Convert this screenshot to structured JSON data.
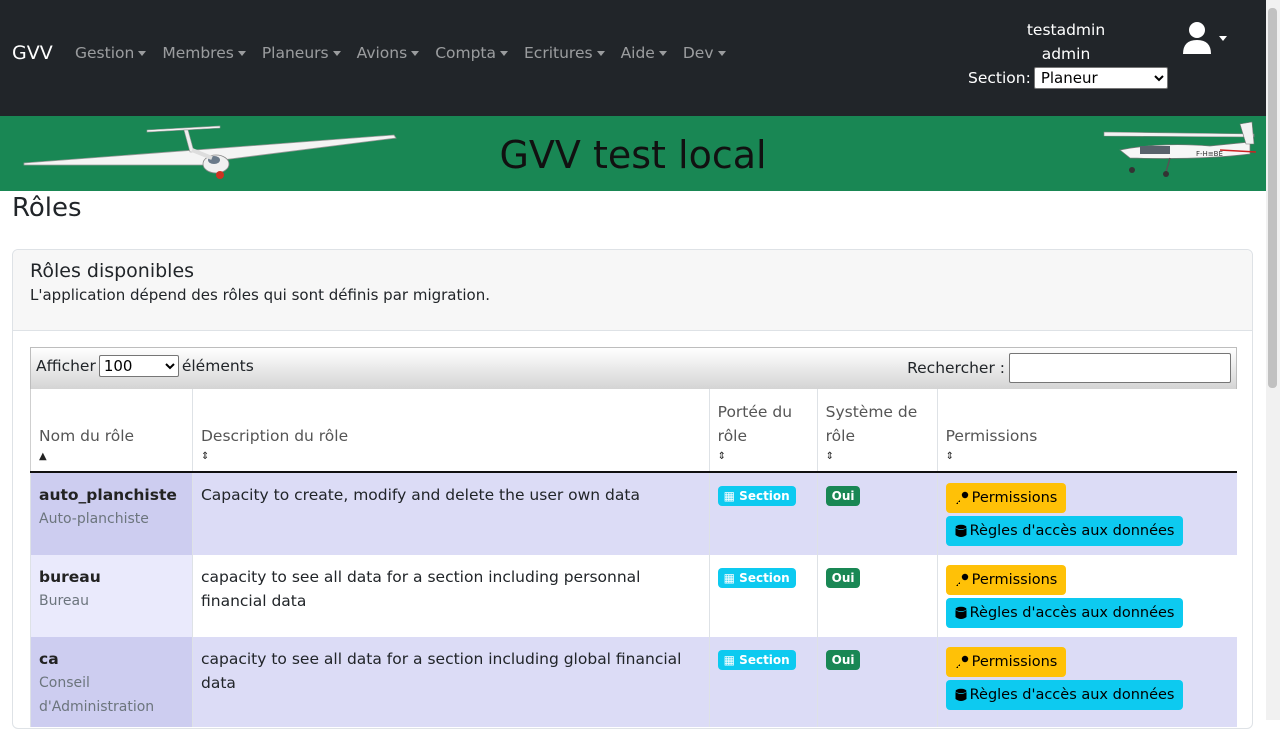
{
  "navbar": {
    "brand": "GVV",
    "menus": [
      "Gestion",
      "Membres",
      "Planeurs",
      "Avions",
      "Compta",
      "Ecritures",
      "Aide",
      "Dev"
    ],
    "user_name": "testadmin",
    "user_role": "admin",
    "section_label": "Section:",
    "section_value": "Planeur"
  },
  "banner": {
    "title": "GVV test local"
  },
  "page": {
    "title": "Rôles"
  },
  "card": {
    "title": "Rôles disponibles",
    "subtitle": "L'application dépend des rôles qui sont définis par migration."
  },
  "datatable": {
    "show_label": "Afficher",
    "page_length": "100",
    "entries_label": "éléments",
    "search_label": "Rechercher :",
    "search_value": ""
  },
  "table": {
    "headers": [
      "Nom du rôle",
      "Description du rôle",
      "Portée du rôle",
      "Système de rôle",
      "Permissions"
    ],
    "rows": [
      {
        "name": "auto_planchiste",
        "label": "Auto-planchiste",
        "description": "Capacity to create, modify and delete the user own data",
        "scope": "Section",
        "system": "Oui",
        "btn_permissions": "Permissions",
        "btn_rules": "Règles d'accès aux données"
      },
      {
        "name": "bureau",
        "label": "Bureau",
        "description": "capacity to see all data for a section including personnal financial data",
        "scope": "Section",
        "system": "Oui",
        "btn_permissions": "Permissions",
        "btn_rules": "Règles d'accès aux données"
      },
      {
        "name": "ca",
        "label": "Conseil d'Administration",
        "description": "capacity to see all data for a section including global financial data",
        "scope": "Section",
        "system": "Oui",
        "btn_permissions": "Permissions",
        "btn_rules": "Règles d'accès aux données"
      }
    ]
  },
  "colors": {
    "navbar": "#212529",
    "banner": "#198754",
    "badge_info": "#0dcaf0",
    "badge_success": "#198754",
    "btn_warning": "#ffc107"
  }
}
